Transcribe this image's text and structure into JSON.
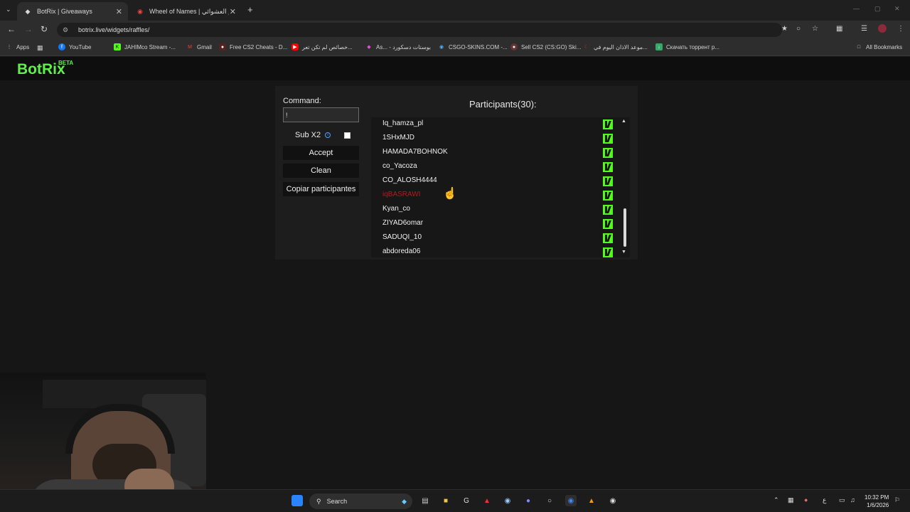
{
  "browser": {
    "tabs": [
      {
        "title": "BotRix | Giveaways",
        "active": true
      },
      {
        "title": "Wheel of Names | اسم العشوائي",
        "active": false
      }
    ],
    "url": "botrix.live/widgets/raffles/",
    "bookmarks": [
      {
        "label": "Apps",
        "icon": "apps-grid-icon"
      },
      {
        "label": "YouTube",
        "icon": "facebook-icon"
      },
      {
        "label": "JAHIMco Stream -...",
        "icon": "kick-icon"
      },
      {
        "label": "Gmail",
        "icon": "gmail-icon"
      },
      {
        "label": "Free CS2 Cheats - D...",
        "icon": "cheat-icon"
      },
      {
        "label": "خصائص لم تكن تعر...",
        "icon": "youtube-icon"
      },
      {
        "label": "As... - بوستات دسكورد",
        "icon": "gem-icon"
      },
      {
        "label": "CSGO-SKINS.COM -...",
        "icon": "skins-icon"
      },
      {
        "label": "Sell CS2 (CS:GO) Ski...",
        "icon": "sell-icon"
      },
      {
        "label": "موعد الاذان اليوم في...",
        "icon": "prayer-icon"
      },
      {
        "label": "Скачать торрент р...",
        "icon": "torrent-icon"
      }
    ],
    "all_bookmarks": "All Bookmarks"
  },
  "site": {
    "logo": "BotRix",
    "logo_badge": "BETA"
  },
  "controls": {
    "command_label": "Command:",
    "command_value": "!",
    "sub_label": "Sub X2",
    "sub_checked": false,
    "accept_label": "Accept",
    "clean_label": "Clean",
    "copy_label": "Copiar participantes"
  },
  "participants": {
    "title": "Participants(30):",
    "visible": [
      {
        "name": "Iq_hamza_pl",
        "highlight": false
      },
      {
        "name": "1SHxMJD",
        "highlight": false
      },
      {
        "name": "HAMADA7BOHNOK",
        "highlight": false
      },
      {
        "name": "co_Yacoza",
        "highlight": false
      },
      {
        "name": "CO_ALOSH4444",
        "highlight": false
      },
      {
        "name": "iqBASRAWI",
        "highlight": true
      },
      {
        "name": "Kyan_co",
        "highlight": false
      },
      {
        "name": "ZIYAD6omar",
        "highlight": false
      },
      {
        "name": "SADUQI_10",
        "highlight": false
      },
      {
        "name": "abdoreda06",
        "highlight": false
      }
    ],
    "platform_icon": "kick-icon",
    "highlight_color": "#c0141e"
  },
  "taskbar": {
    "search_label": "Search",
    "time": "10:32 PM",
    "date": "1/6/2026",
    "lang": "ع"
  },
  "colors": {
    "brand": "#5ff04a",
    "kick": "#53fc18",
    "panel_bg": "#1d1d1d"
  }
}
